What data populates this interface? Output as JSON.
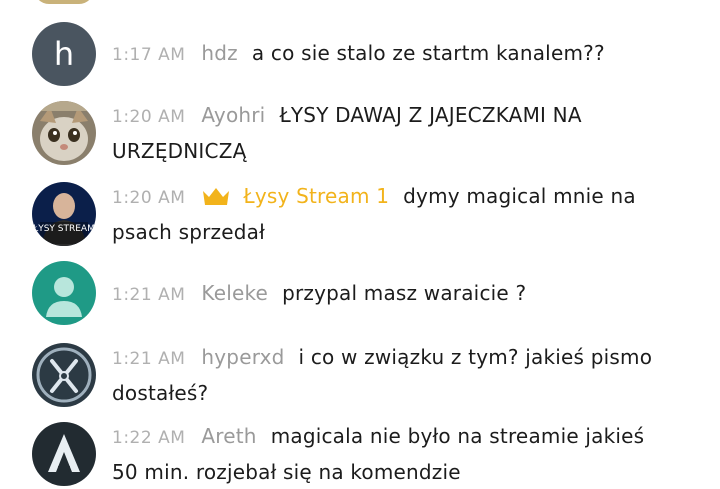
{
  "messages": [
    {
      "id": "hdz",
      "avatar": {
        "type": "letter",
        "letter": "h",
        "color": "#4a5560"
      },
      "time": "1:17 AM",
      "author": "hdz",
      "text": "a co sie stalo ze startm kanalem??",
      "is_owner": false
    },
    {
      "id": "ayohri",
      "avatar": {
        "type": "photo",
        "icon": "cat-photo-icon"
      },
      "time": "1:20 AM",
      "author": "Ayohri",
      "text": "ŁYSY DAWAJ Z JAJECZKAMI NA URZĘDNICZĄ",
      "is_owner": false
    },
    {
      "id": "lysy",
      "avatar": {
        "type": "photo",
        "icon": "lysy-stream-photo-icon",
        "caption": "ŁYSY STREAM"
      },
      "time": "1:20 AM",
      "author": "Łysy Stream 1",
      "text": "dymy  magical mnie na psach sprzedał",
      "is_owner": true,
      "badge_icon": "crown-icon",
      "owner_color": "#f2b31b"
    },
    {
      "id": "keleke",
      "avatar": {
        "type": "default",
        "icon": "default-user-icon",
        "color": "#1f9a86"
      },
      "time": "1:21 AM",
      "author": "Keleke",
      "text": "przypal masz waraicie ?",
      "is_owner": false
    },
    {
      "id": "hyperxd",
      "avatar": {
        "type": "logo",
        "icon": "crossed-pliers-logo-icon",
        "color": "#2c3a44"
      },
      "time": "1:21 AM",
      "author": "hyperxd",
      "text": "i co w związku z tym? jakieś pismo dostałeś?",
      "is_owner": false
    },
    {
      "id": "areth",
      "avatar": {
        "type": "logo",
        "icon": "arrow-a-logo-icon",
        "color": "#222b31"
      },
      "time": "1:22 AM",
      "author": "Areth",
      "text": "magicala nie było na streamie jakieś 50 min. rozjebał się na komendzie",
      "is_owner": false
    }
  ]
}
